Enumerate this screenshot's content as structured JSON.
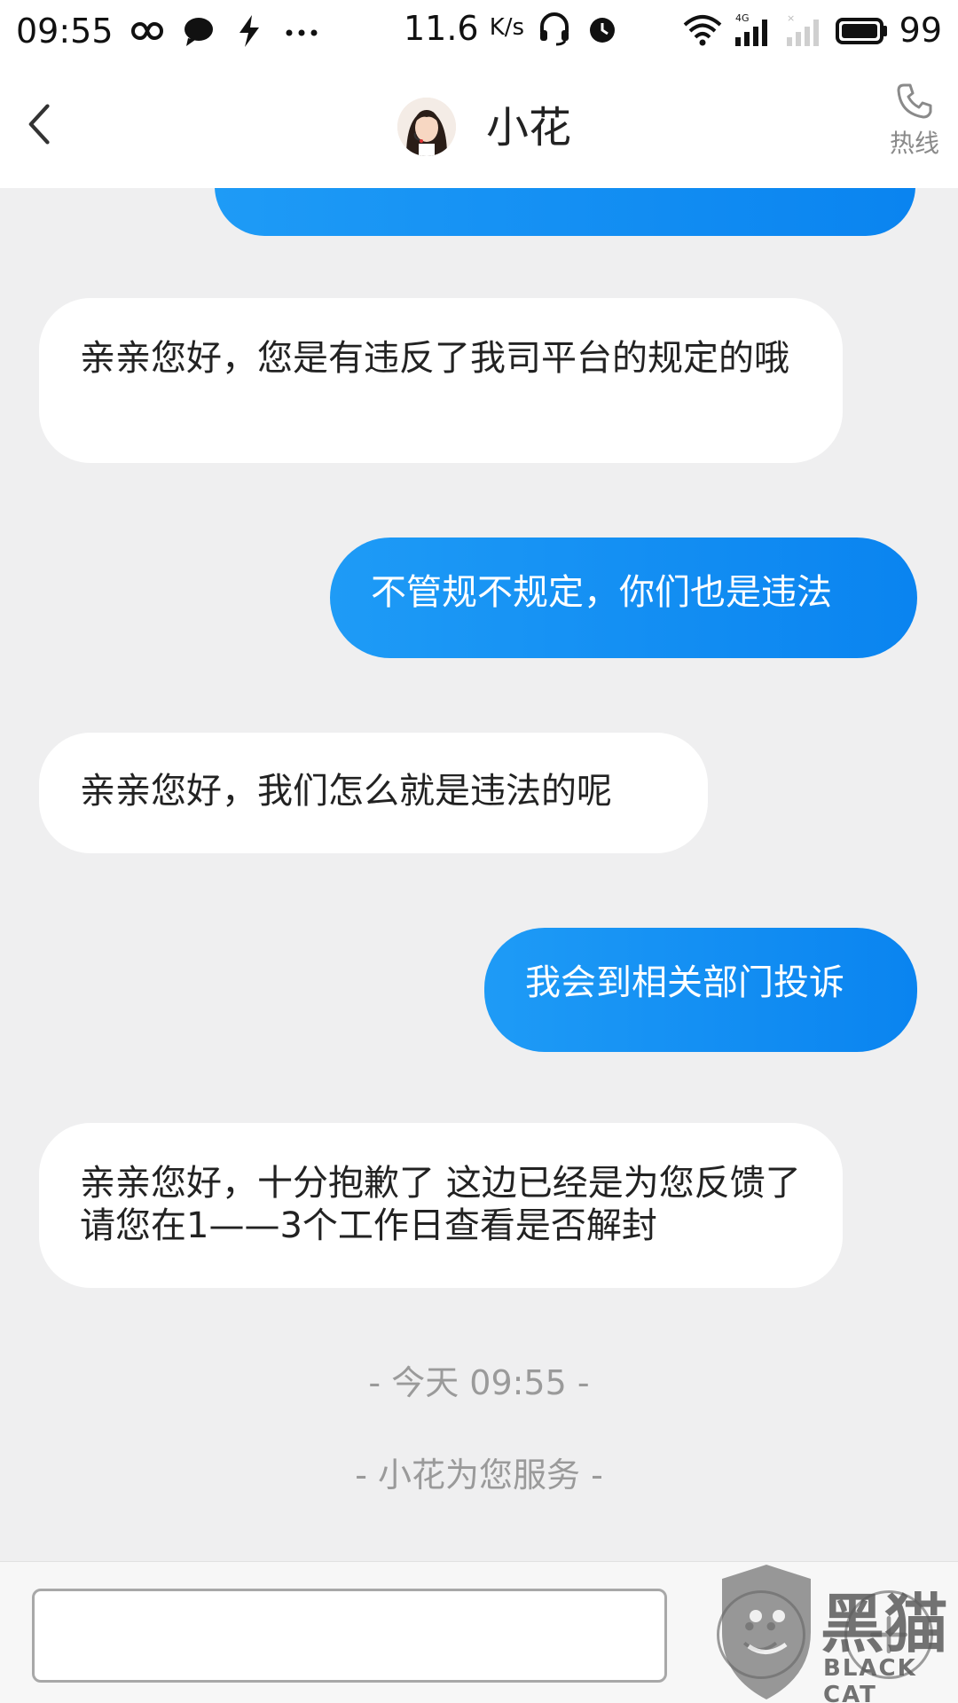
{
  "status_bar": {
    "time": "09:55",
    "speed": "11.6",
    "speed_unit": "K/s",
    "network": "4G",
    "battery": "99"
  },
  "header": {
    "contact_name": "小花",
    "hotline_label": "热线"
  },
  "messages": [
    {
      "side": "in",
      "text": "亲亲您好，您是有违反了我司平台的规定的哦"
    },
    {
      "side": "out",
      "text": "不管规不规定，你们也是违法"
    },
    {
      "side": "in",
      "text": "亲亲您好，我们怎么就是违法的呢"
    },
    {
      "side": "out",
      "text": "我会到相关部门投诉"
    },
    {
      "side": "in",
      "text": "亲亲您好，十分抱歉了 这边已经是为您反馈了 请您在1——3个工作日查看是否解封"
    }
  ],
  "system": {
    "timestamp": "- 今天 09:55 -",
    "service_note": "- 小花为您服务 -"
  },
  "input": {
    "value": "",
    "placeholder": ""
  },
  "watermark": {
    "title": "黑猫",
    "subtitle": "BLACK CAT"
  },
  "colors": {
    "outgoing_bubble": "#1e9bf6",
    "incoming_bubble": "#ffffff",
    "background": "#efeff0"
  },
  "icons": [
    "back-icon",
    "phone-icon",
    "emoji-icon",
    "plus-icon",
    "wifi-icon",
    "battery-icon",
    "headset-icon"
  ]
}
